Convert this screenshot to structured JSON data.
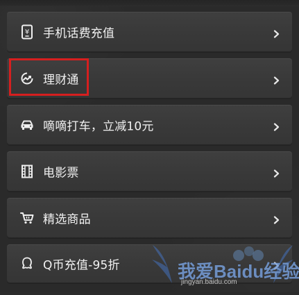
{
  "menu": {
    "items": [
      {
        "label": "手机话费充值",
        "icon": "phone-recharge-icon"
      },
      {
        "label": "理财通",
        "icon": "wealth-chart-icon"
      },
      {
        "label": "嘀嘀打车，立减10元",
        "icon": "car-icon"
      },
      {
        "label": "电影票",
        "icon": "film-icon"
      },
      {
        "label": "精选商品",
        "icon": "shopping-cart-icon"
      },
      {
        "label": "Q币充值-95折",
        "icon": "qq-icon"
      }
    ]
  },
  "watermark": {
    "main": "我爱Baidu经验",
    "sub": "jingyan.baidu.com"
  },
  "colors": {
    "background": "#2a2a2a",
    "row": "#3a3a3a",
    "text": "#f1f1f1",
    "highlight": "#d61f1f",
    "watermark": "#78a0dc"
  }
}
